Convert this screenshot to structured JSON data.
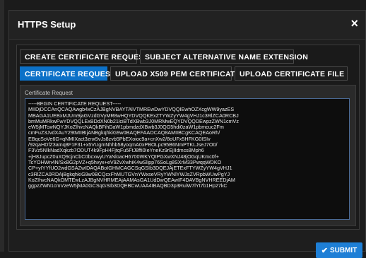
{
  "modal": {
    "title": "HTTPS Setup",
    "close_glyph": "×"
  },
  "tabs": [
    {
      "label": "CREATE CERTIFICATE REQUEST",
      "active": false
    },
    {
      "label": "SUBJECT ALTERNATIVE NAME EXTENSION",
      "active": false
    },
    {
      "label": "CERTIFICATE REQUEST",
      "active": true
    },
    {
      "label": "UPLOAD X509 PEM CERTIFICATE",
      "active": false
    },
    {
      "label": "UPLOAD CERTIFICATE FILE",
      "active": false
    }
  ],
  "certificate_request": {
    "label": "Certificate Request",
    "value": "-----BEGIN CERTIFICATE REQUEST-----\nMIIDjDCCAnQCAQAwgb4xCzAJBgNVBAYTAlVTMREwDwYDVQQIEwhOZXcgWW9yazES\nMBAGA1UEBxMJUm9jaGVzdGVyMR8wHQYDVQQKExZTYWZyYW4gVHJ1c3RlZCA0RCBJ\nbmMuMRkwFwYDVQQLExBDdXN0b21lciBTdXBwb3J0MRMwEQYDVQQDEwpzZWN1cmVz\neW5jMTcwNQYJKoZIhvcNAQkBFihDaW1pbmdzdXBwb3J0QG5hdi0zaW1pbmcuc2Fm\ncmFuZ3JvdXAuY29tMIIBIjANBgkqhkiG9w0BAQEFAAOCAQ8AMIIBCgKCAQEAoRh/\nEBqcSoVe6G+qNMIXact3znx5vJs8zvb5PbEXoioc9a+cnXw2/8oUFx5HFKG0ISIv\n/92qaHDfZ3aInq8F1F31+x5VUgmNhhb58yoqmA0xPBOLpc95B6NmPTKLJseJ7O0/\nF3Vz5NlkNadXqkzb7ODUT4k9FpH4FjtqFu5FtJ8ffi0IeYneKz9rEjIIdmcs8Mph6\n+jH8JupcZ0uXQ9cjnCbC0bcxwyUYaNloacH6700WKYQtPGXwXNJ48jOGqUKmc0f+\nTcYOHWn4N/SxBG2pVZ+q5hvyx+eV9ZvXwhiK4wSlipp76SoLg8SXrM33PwqqWDKO\nCP+yIYYfUO2wdGSAZwIDAQABoIGHMCAGCSqGSIb3DQEJAjETExFTYWZyYW4gVHJ1\nc3RlZCA0RDAjBgkqhkiG9w0BCQcxFhMUTGVnYWxseVRyYWNlYWJsZVRpbWUwPgYJ\nKoZIhvcNAQkOMTEwLzAJBgNVHRMEAjAAMAsGA1UdDwQEAwIF4DAVBgNVHREEDjAM\nggpzZWN1cmVzeW5jMA0GCSqGSIb3DQEBCwUAA4IBAQBD3p3RuiW7lYt7b1Hp27kC"
  },
  "submit": {
    "label": "SUBMIT",
    "icon": "check-icon",
    "color": "#1e7fd6"
  },
  "colors": {
    "tab_active": "#0c71c8",
    "background": "#1b1b1b"
  }
}
